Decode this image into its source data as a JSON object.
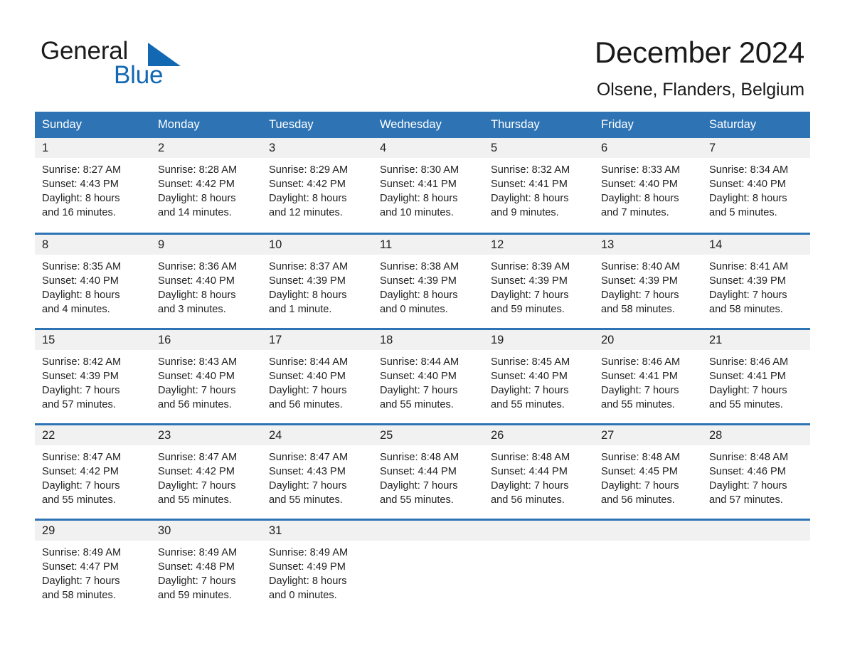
{
  "brand": {
    "word1": "General",
    "word2": "Blue",
    "logo_icon": "triangle-logo-icon",
    "accent_color": "#1268b3"
  },
  "header": {
    "month_title": "December 2024",
    "location": "Olsene, Flanders, Belgium"
  },
  "calendar": {
    "header_bg": "#2e74b5",
    "daynum_bg": "#f1f1f1",
    "weekday_headers": [
      "Sunday",
      "Monday",
      "Tuesday",
      "Wednesday",
      "Thursday",
      "Friday",
      "Saturday"
    ],
    "weeks": [
      [
        {
          "day": "1",
          "sunrise": "Sunrise: 8:27 AM",
          "sunset": "Sunset: 4:43 PM",
          "daylight1": "Daylight: 8 hours",
          "daylight2": "and 16 minutes."
        },
        {
          "day": "2",
          "sunrise": "Sunrise: 8:28 AM",
          "sunset": "Sunset: 4:42 PM",
          "daylight1": "Daylight: 8 hours",
          "daylight2": "and 14 minutes."
        },
        {
          "day": "3",
          "sunrise": "Sunrise: 8:29 AM",
          "sunset": "Sunset: 4:42 PM",
          "daylight1": "Daylight: 8 hours",
          "daylight2": "and 12 minutes."
        },
        {
          "day": "4",
          "sunrise": "Sunrise: 8:30 AM",
          "sunset": "Sunset: 4:41 PM",
          "daylight1": "Daylight: 8 hours",
          "daylight2": "and 10 minutes."
        },
        {
          "day": "5",
          "sunrise": "Sunrise: 8:32 AM",
          "sunset": "Sunset: 4:41 PM",
          "daylight1": "Daylight: 8 hours",
          "daylight2": "and 9 minutes."
        },
        {
          "day": "6",
          "sunrise": "Sunrise: 8:33 AM",
          "sunset": "Sunset: 4:40 PM",
          "daylight1": "Daylight: 8 hours",
          "daylight2": "and 7 minutes."
        },
        {
          "day": "7",
          "sunrise": "Sunrise: 8:34 AM",
          "sunset": "Sunset: 4:40 PM",
          "daylight1": "Daylight: 8 hours",
          "daylight2": "and 5 minutes."
        }
      ],
      [
        {
          "day": "8",
          "sunrise": "Sunrise: 8:35 AM",
          "sunset": "Sunset: 4:40 PM",
          "daylight1": "Daylight: 8 hours",
          "daylight2": "and 4 minutes."
        },
        {
          "day": "9",
          "sunrise": "Sunrise: 8:36 AM",
          "sunset": "Sunset: 4:40 PM",
          "daylight1": "Daylight: 8 hours",
          "daylight2": "and 3 minutes."
        },
        {
          "day": "10",
          "sunrise": "Sunrise: 8:37 AM",
          "sunset": "Sunset: 4:39 PM",
          "daylight1": "Daylight: 8 hours",
          "daylight2": "and 1 minute."
        },
        {
          "day": "11",
          "sunrise": "Sunrise: 8:38 AM",
          "sunset": "Sunset: 4:39 PM",
          "daylight1": "Daylight: 8 hours",
          "daylight2": "and 0 minutes."
        },
        {
          "day": "12",
          "sunrise": "Sunrise: 8:39 AM",
          "sunset": "Sunset: 4:39 PM",
          "daylight1": "Daylight: 7 hours",
          "daylight2": "and 59 minutes."
        },
        {
          "day": "13",
          "sunrise": "Sunrise: 8:40 AM",
          "sunset": "Sunset: 4:39 PM",
          "daylight1": "Daylight: 7 hours",
          "daylight2": "and 58 minutes."
        },
        {
          "day": "14",
          "sunrise": "Sunrise: 8:41 AM",
          "sunset": "Sunset: 4:39 PM",
          "daylight1": "Daylight: 7 hours",
          "daylight2": "and 58 minutes."
        }
      ],
      [
        {
          "day": "15",
          "sunrise": "Sunrise: 8:42 AM",
          "sunset": "Sunset: 4:39 PM",
          "daylight1": "Daylight: 7 hours",
          "daylight2": "and 57 minutes."
        },
        {
          "day": "16",
          "sunrise": "Sunrise: 8:43 AM",
          "sunset": "Sunset: 4:40 PM",
          "daylight1": "Daylight: 7 hours",
          "daylight2": "and 56 minutes."
        },
        {
          "day": "17",
          "sunrise": "Sunrise: 8:44 AM",
          "sunset": "Sunset: 4:40 PM",
          "daylight1": "Daylight: 7 hours",
          "daylight2": "and 56 minutes."
        },
        {
          "day": "18",
          "sunrise": "Sunrise: 8:44 AM",
          "sunset": "Sunset: 4:40 PM",
          "daylight1": "Daylight: 7 hours",
          "daylight2": "and 55 minutes."
        },
        {
          "day": "19",
          "sunrise": "Sunrise: 8:45 AM",
          "sunset": "Sunset: 4:40 PM",
          "daylight1": "Daylight: 7 hours",
          "daylight2": "and 55 minutes."
        },
        {
          "day": "20",
          "sunrise": "Sunrise: 8:46 AM",
          "sunset": "Sunset: 4:41 PM",
          "daylight1": "Daylight: 7 hours",
          "daylight2": "and 55 minutes."
        },
        {
          "day": "21",
          "sunrise": "Sunrise: 8:46 AM",
          "sunset": "Sunset: 4:41 PM",
          "daylight1": "Daylight: 7 hours",
          "daylight2": "and 55 minutes."
        }
      ],
      [
        {
          "day": "22",
          "sunrise": "Sunrise: 8:47 AM",
          "sunset": "Sunset: 4:42 PM",
          "daylight1": "Daylight: 7 hours",
          "daylight2": "and 55 minutes."
        },
        {
          "day": "23",
          "sunrise": "Sunrise: 8:47 AM",
          "sunset": "Sunset: 4:42 PM",
          "daylight1": "Daylight: 7 hours",
          "daylight2": "and 55 minutes."
        },
        {
          "day": "24",
          "sunrise": "Sunrise: 8:47 AM",
          "sunset": "Sunset: 4:43 PM",
          "daylight1": "Daylight: 7 hours",
          "daylight2": "and 55 minutes."
        },
        {
          "day": "25",
          "sunrise": "Sunrise: 8:48 AM",
          "sunset": "Sunset: 4:44 PM",
          "daylight1": "Daylight: 7 hours",
          "daylight2": "and 55 minutes."
        },
        {
          "day": "26",
          "sunrise": "Sunrise: 8:48 AM",
          "sunset": "Sunset: 4:44 PM",
          "daylight1": "Daylight: 7 hours",
          "daylight2": "and 56 minutes."
        },
        {
          "day": "27",
          "sunrise": "Sunrise: 8:48 AM",
          "sunset": "Sunset: 4:45 PM",
          "daylight1": "Daylight: 7 hours",
          "daylight2": "and 56 minutes."
        },
        {
          "day": "28",
          "sunrise": "Sunrise: 8:48 AM",
          "sunset": "Sunset: 4:46 PM",
          "daylight1": "Daylight: 7 hours",
          "daylight2": "and 57 minutes."
        }
      ],
      [
        {
          "day": "29",
          "sunrise": "Sunrise: 8:49 AM",
          "sunset": "Sunset: 4:47 PM",
          "daylight1": "Daylight: 7 hours",
          "daylight2": "and 58 minutes."
        },
        {
          "day": "30",
          "sunrise": "Sunrise: 8:49 AM",
          "sunset": "Sunset: 4:48 PM",
          "daylight1": "Daylight: 7 hours",
          "daylight2": "and 59 minutes."
        },
        {
          "day": "31",
          "sunrise": "Sunrise: 8:49 AM",
          "sunset": "Sunset: 4:49 PM",
          "daylight1": "Daylight: 8 hours",
          "daylight2": "and 0 minutes."
        },
        {
          "day": "",
          "sunrise": "",
          "sunset": "",
          "daylight1": "",
          "daylight2": ""
        },
        {
          "day": "",
          "sunrise": "",
          "sunset": "",
          "daylight1": "",
          "daylight2": ""
        },
        {
          "day": "",
          "sunrise": "",
          "sunset": "",
          "daylight1": "",
          "daylight2": ""
        },
        {
          "day": "",
          "sunrise": "",
          "sunset": "",
          "daylight1": "",
          "daylight2": ""
        }
      ]
    ]
  }
}
